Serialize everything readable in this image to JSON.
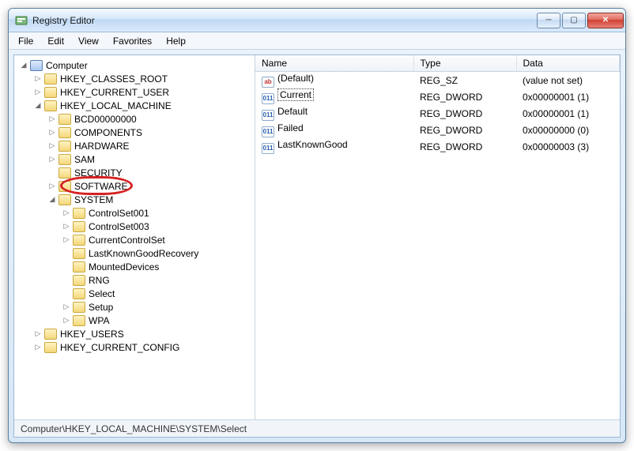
{
  "title": "Registry Editor",
  "menus": {
    "file": "File",
    "edit": "Edit",
    "view": "View",
    "favorites": "Favorites",
    "help": "Help"
  },
  "tree": {
    "root": "Computer",
    "hkcr": "HKEY_CLASSES_ROOT",
    "hkcu": "HKEY_CURRENT_USER",
    "hklm": "HKEY_LOCAL_MACHINE",
    "hklm_children": {
      "bcd": "BCD00000000",
      "components": "COMPONENTS",
      "hardware": "HARDWARE",
      "sam": "SAM",
      "security": "SECURITY",
      "software": "SOFTWARE",
      "system": "SYSTEM"
    },
    "system_children": {
      "cs001": "ControlSet001",
      "cs003": "ControlSet003",
      "ccs": "CurrentControlSet",
      "lkgr": "LastKnownGoodRecovery",
      "md": "MountedDevices",
      "rng": "RNG",
      "select": "Select",
      "setup": "Setup",
      "wpa": "WPA"
    },
    "hku": "HKEY_USERS",
    "hkcc": "HKEY_CURRENT_CONFIG"
  },
  "columns": {
    "name": "Name",
    "type": "Type",
    "data": "Data"
  },
  "values": [
    {
      "name": "(Default)",
      "type": "REG_SZ",
      "data": "(value not set)",
      "kind": "sz",
      "selected": false
    },
    {
      "name": "Current",
      "type": "REG_DWORD",
      "data": "0x00000001 (1)",
      "kind": "dw",
      "selected": true
    },
    {
      "name": "Default",
      "type": "REG_DWORD",
      "data": "0x00000001 (1)",
      "kind": "dw",
      "selected": false
    },
    {
      "name": "Failed",
      "type": "REG_DWORD",
      "data": "0x00000000 (0)",
      "kind": "dw",
      "selected": false
    },
    {
      "name": "LastKnownGood",
      "type": "REG_DWORD",
      "data": "0x00000003 (3)",
      "kind": "dw",
      "selected": false
    }
  ],
  "statusbar": "Computer\\HKEY_LOCAL_MACHINE\\SYSTEM\\Select",
  "highlighted_node": "SOFTWARE",
  "icon_glyphs": {
    "sz": "ab",
    "dw": "011"
  }
}
